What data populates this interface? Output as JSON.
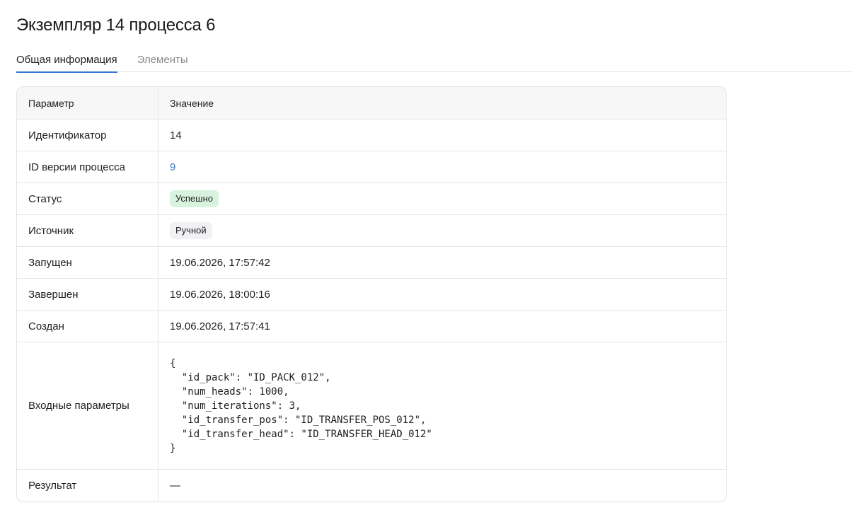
{
  "page": {
    "title": "Экземпляр 14 процесса 6"
  },
  "tabs": [
    {
      "label": "Общая информация",
      "active": true
    },
    {
      "label": "Элементы",
      "active": false
    }
  ],
  "table": {
    "headers": {
      "param": "Параметр",
      "value": "Значение"
    },
    "rows": {
      "id": {
        "label": "Идентификатор",
        "value": "14"
      },
      "version": {
        "label": "ID версии процесса",
        "value": "9"
      },
      "status": {
        "label": "Статус",
        "value": "Успешно"
      },
      "source": {
        "label": "Источник",
        "value": "Ручной"
      },
      "started": {
        "label": "Запущен",
        "value": "19.06.2026, 17:57:42"
      },
      "finished": {
        "label": "Завершен",
        "value": "19.06.2026, 18:00:16"
      },
      "created": {
        "label": "Создан",
        "value": "19.06.2026, 17:57:41"
      },
      "input": {
        "label": "Входные параметры",
        "value": "{\n  \"id_pack\": \"ID_PACK_012\",\n  \"num_heads\": 1000,\n  \"num_iterations\": 3,\n  \"id_transfer_pos\": \"ID_TRANSFER_POS_012\",\n  \"id_transfer_head\": \"ID_TRANSFER_HEAD_012\"\n}"
      },
      "result": {
        "label": "Результат",
        "value": "—"
      }
    }
  },
  "colors": {
    "accent": "#2f78d6",
    "success_badge_bg": "#d8f3dd",
    "neutral_badge_bg": "#f1f1f4"
  }
}
